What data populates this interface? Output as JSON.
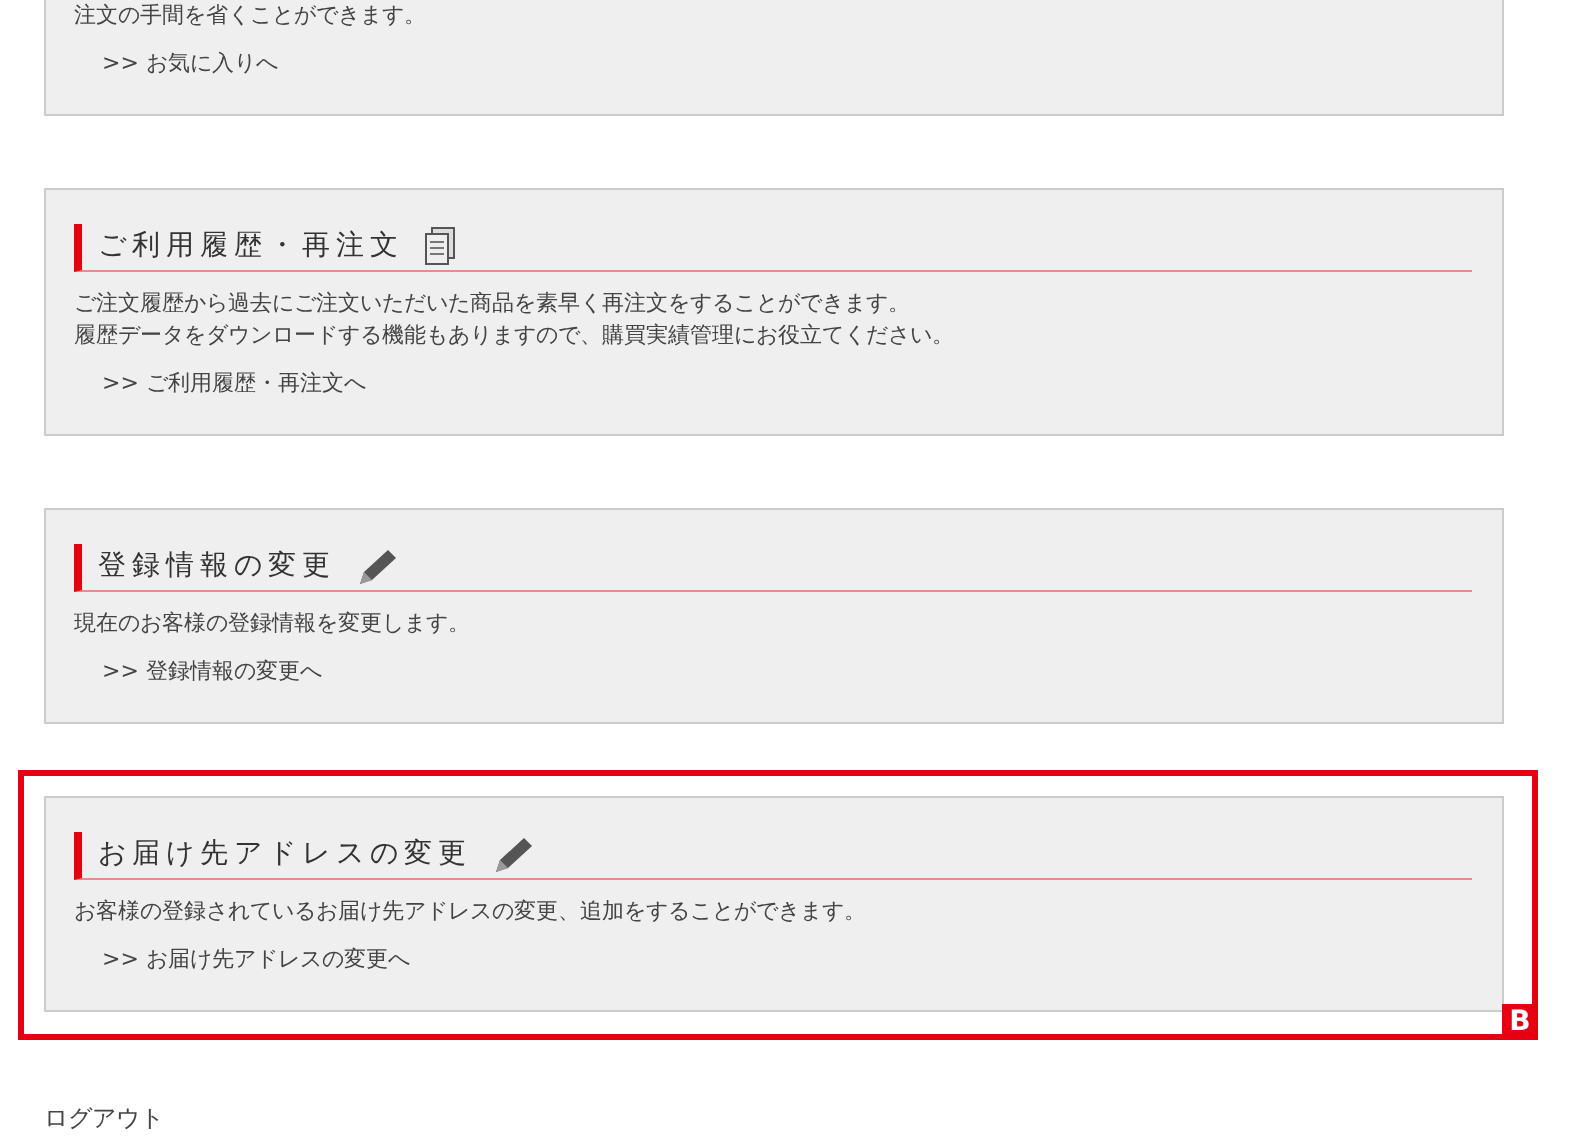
{
  "sections": [
    {
      "description": [
        "注文の手間を省くことができます。"
      ],
      "link": ">> お気に入りへ"
    },
    {
      "title": "ご利用履歴・再注文",
      "kind": "document",
      "description": [
        "ご注文履歴から過去にご注文いただいた商品を素早く再注文をすることができます。",
        "履歴データをダウンロードする機能もありますので、購買実績管理にお役立てください。"
      ],
      "link": ">> ご利用履歴・再注文へ"
    },
    {
      "title": "登録情報の変更",
      "kind": "pencil",
      "description": [
        "現在のお客様の登録情報を変更します。"
      ],
      "link": ">> 登録情報の変更へ"
    },
    {
      "title": "お届け先アドレスの変更",
      "kind": "pencil",
      "description": [
        "お客様の登録されているお届け先アドレスの変更、追加をすることができます。"
      ],
      "link": ">> お届け先アドレスの変更へ",
      "callout": "B"
    }
  ],
  "logout": "ログアウト"
}
